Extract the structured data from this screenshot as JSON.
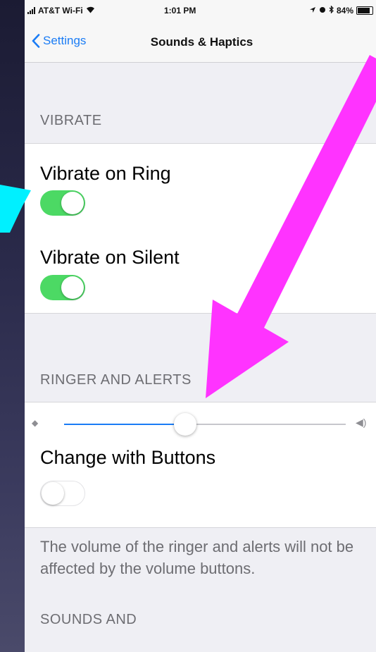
{
  "status_bar": {
    "carrier": "AT&T Wi-Fi",
    "time": "1:01 PM",
    "battery": "84%"
  },
  "nav": {
    "back_label": "Settings",
    "title": "Sounds & Haptics"
  },
  "vibrate": {
    "header": "VIBRATE",
    "items": [
      {
        "label": "Vibrate on Ring",
        "state": "on"
      },
      {
        "label": "Vibrate on Silent",
        "state": "on"
      }
    ]
  },
  "ringer": {
    "header": "RINGER AND ALERTS",
    "volume_level": 0.43,
    "change_with_buttons": {
      "label": "Change with Buttons",
      "state": "off"
    },
    "footer": "The volume of the ringer and alerts will not be affected by the volume buttons."
  },
  "sounds": {
    "header": "SOUNDS AND"
  },
  "annotations": {
    "cyan_arrow_color": "#00f0ff",
    "magenta_arrow_color": "#ff33ff"
  },
  "colors": {
    "toggle_on": "#4cd964",
    "accent_blue": "#1a7cf5"
  }
}
